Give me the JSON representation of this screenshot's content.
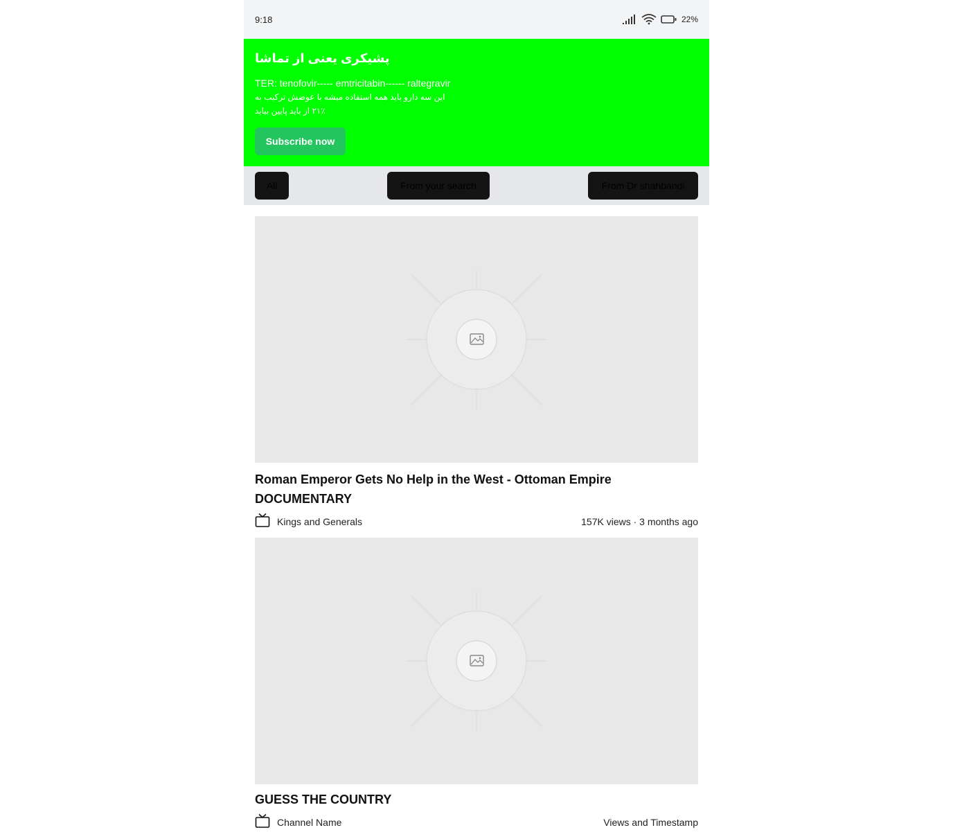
{
  "status_bar": {
    "time": "9:18",
    "battery": "22%",
    "icons": [
      "signal-icon",
      "wifi-icon",
      "battery-icon"
    ]
  },
  "banner": {
    "title": "پشیکری یعنی از تماشا",
    "line1": "TER: tenofovir----- emtricitabin------ raltegravir",
    "line2": "این سه دارو باید همه استفاده میشه با عوضش ترکیب به",
    "line3": "۲۱٪ از باید پایین بیاید",
    "button_label": "Subscribe now",
    "background_color": "#00ff00",
    "button_color": "#22c55e"
  },
  "filters": {
    "chips": [
      "All",
      "From your search",
      "From Dr shahbandi"
    ]
  },
  "videos": [
    {
      "title": "Roman Emperor Gets No Help in the West - Ottoman Empire DOCUMENTARY",
      "channel": "Kings and Generals",
      "meta": "157K views · 3 months ago",
      "thumbnail_icon": "image-placeholder-icon",
      "channel_icon": "tv-icon"
    },
    {
      "title": "GUESS THE COUNTRY",
      "channel": "Channel Name",
      "meta": "Views and Timestamp",
      "thumbnail_icon": "image-placeholder-icon",
      "channel_icon": "tv-icon"
    }
  ]
}
